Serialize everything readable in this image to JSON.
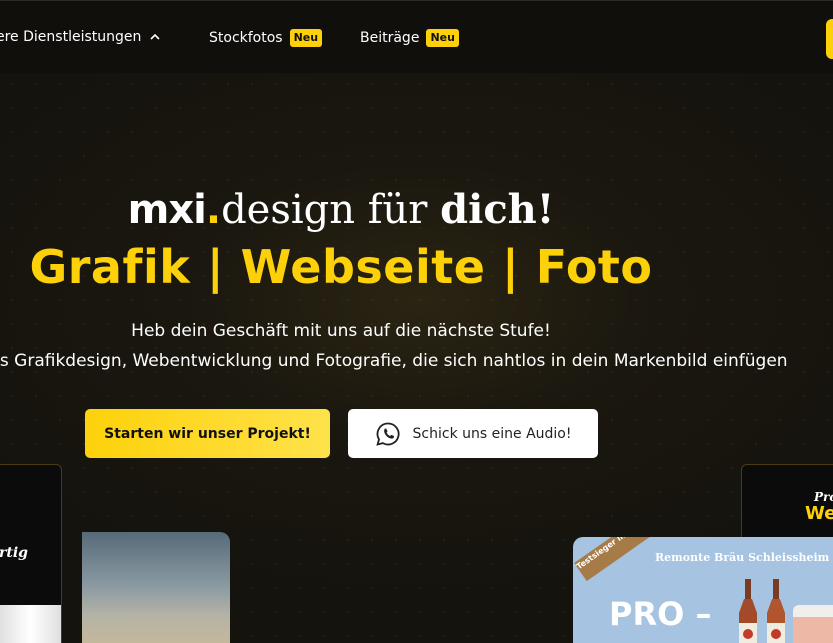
{
  "nav": {
    "items": [
      {
        "label": "ere Dienstleistungen",
        "icon": "chevron-up-icon"
      },
      {
        "label": "Stockfotos",
        "badge": "Neu"
      },
      {
        "label": "Beiträge",
        "badge": "Neu"
      }
    ]
  },
  "hero": {
    "brand": "mxi",
    "brand_dot": ".",
    "line1_mid": "design für ",
    "line1_emph": "dich!",
    "line2": "Grafik | Webseite | Foto",
    "sub1": "Heb dein Geschäft mit uns auf die nächste Stufe!",
    "sub2": "ntes Grafikdesign, Webentwicklung und Fotografie, die sich nahtlos in dein Markenbild einfügen"
  },
  "buttons": {
    "primary": "Starten wir unser Projekt!",
    "secondary": "Schick uns eine Audio!",
    "secondary_icon": "whatsapp-icon"
  },
  "cards": {
    "left_text": "rtig",
    "right_top_a": "Pro",
    "right_top_b": "We",
    "beer_header": "Remonte Bräu Schleissheim",
    "beer_stamp": "Testsieger im Landkreis",
    "beer_pro": "PRO –"
  },
  "colors": {
    "accent": "#fdd10a",
    "background": "#15130e",
    "nav": "#100f0c"
  }
}
